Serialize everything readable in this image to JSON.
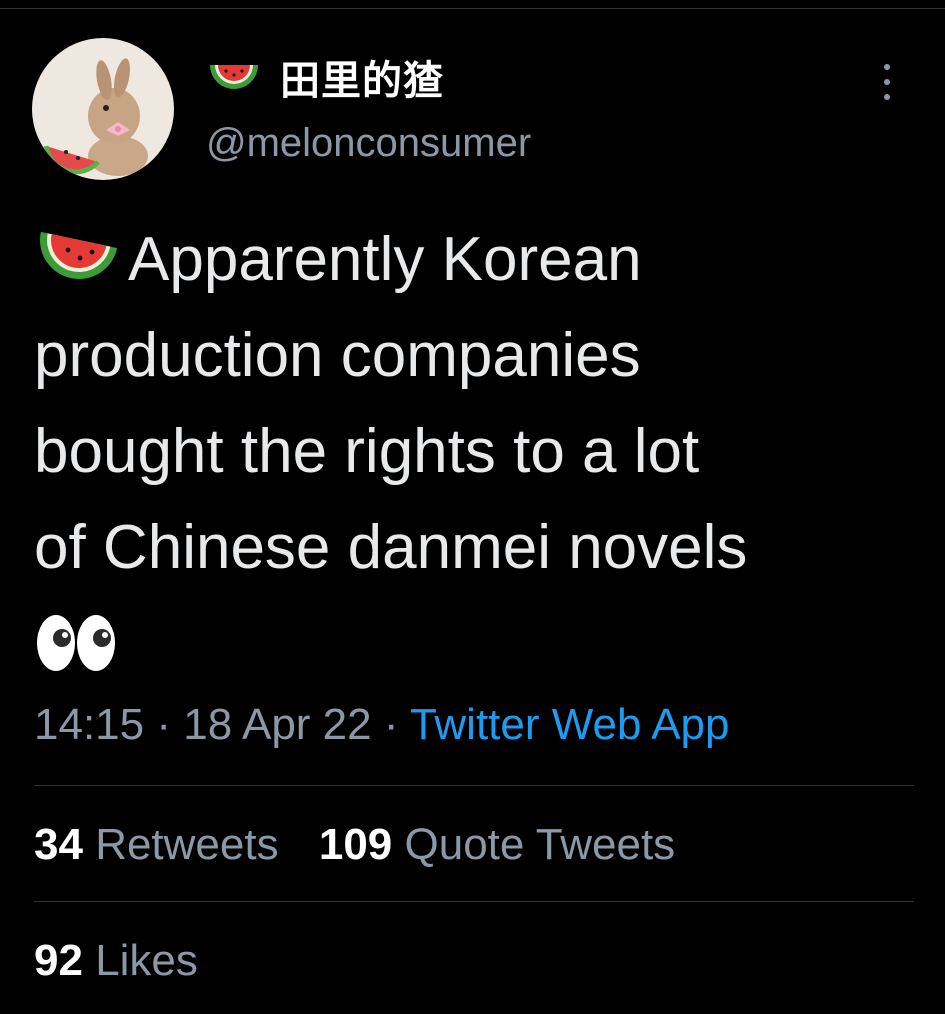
{
  "user": {
    "display_name": "田里的猹",
    "handle": "@melonconsumer",
    "avatar_icon": "rabbit-with-watermelon-avatar",
    "name_prefix_icon": "watermelon-icon"
  },
  "tweet": {
    "lines": [
      "Apparently Korean",
      "production companies",
      "bought the rights to a lot",
      "of Chinese danmei novels"
    ],
    "leading_icon": "watermelon-icon",
    "trailing_icon": "eyes-icon",
    "time": "14:15",
    "date": "18 Apr 22",
    "separator": "·",
    "source": "Twitter Web App"
  },
  "stats": {
    "retweets_count": "34",
    "retweets_label": "Retweets",
    "quote_count": "109",
    "quote_label": "Quote Tweets",
    "likes_count": "92",
    "likes_label": "Likes"
  },
  "colors": {
    "background": "#000000",
    "primary_text": "#e7e9ea",
    "secondary_text": "#8b98a5",
    "link": "#1d9bf0",
    "divider": "#2f3336"
  }
}
